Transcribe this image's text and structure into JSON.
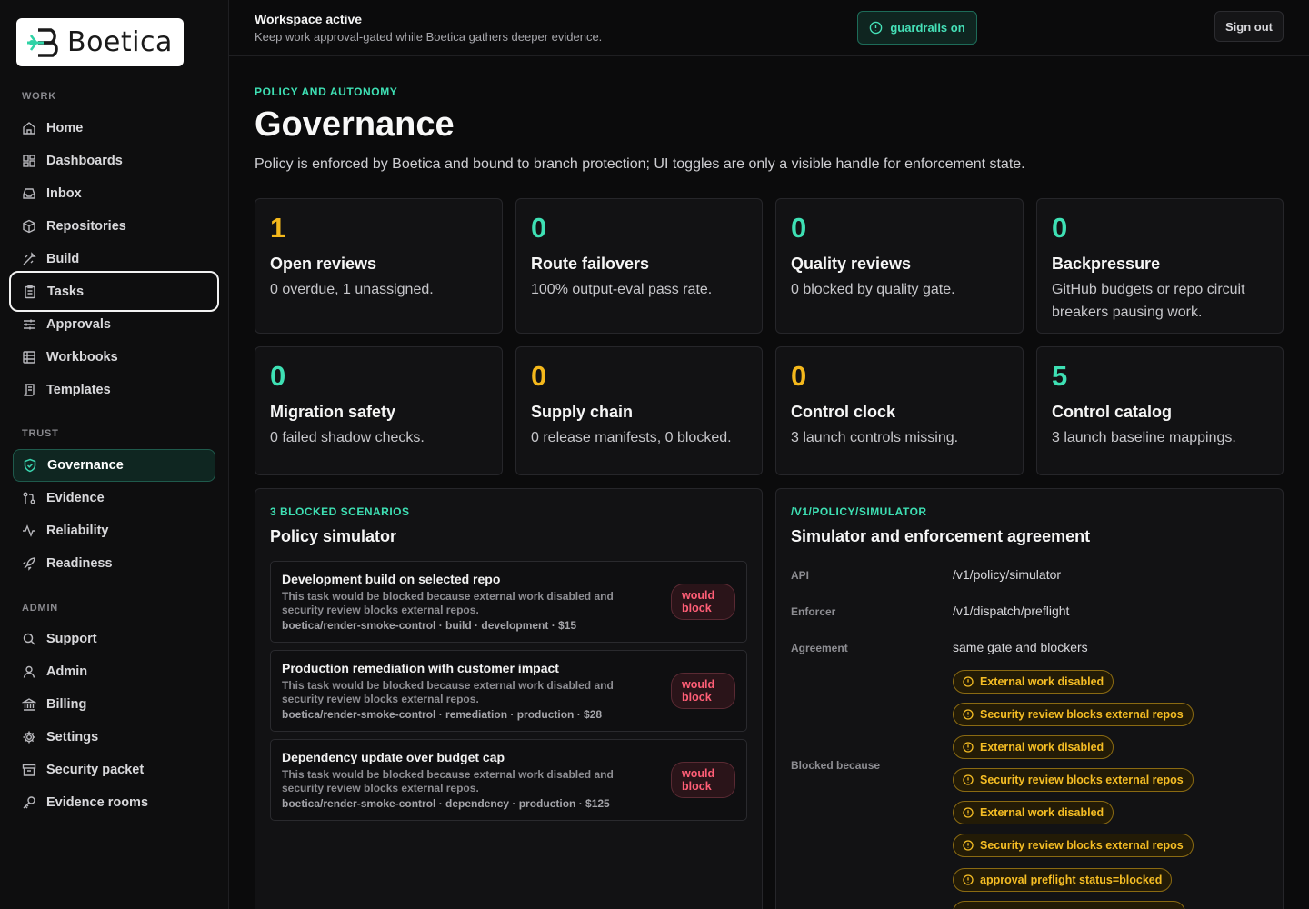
{
  "brand": {
    "name": "Boetica"
  },
  "sidebar": {
    "sections": [
      {
        "label": "WORK"
      },
      {
        "label": "TRUST"
      },
      {
        "label": "ADMIN"
      }
    ],
    "items": [
      {
        "label": "Home",
        "icon": "home-icon"
      },
      {
        "label": "Dashboards",
        "icon": "dashboard-icon"
      },
      {
        "label": "Inbox",
        "icon": "inbox-icon"
      },
      {
        "label": "Repositories",
        "icon": "package-icon"
      },
      {
        "label": "Build",
        "icon": "build-icon"
      },
      {
        "label": "Tasks",
        "icon": "clipboard-icon"
      },
      {
        "label": "Approvals",
        "icon": "sliders-icon"
      },
      {
        "label": "Workbooks",
        "icon": "table-icon"
      },
      {
        "label": "Templates",
        "icon": "scroll-icon"
      },
      {
        "label": "Governance",
        "icon": "shield-check-icon"
      },
      {
        "label": "Evidence",
        "icon": "git-compare-icon"
      },
      {
        "label": "Reliability",
        "icon": "activity-icon"
      },
      {
        "label": "Readiness",
        "icon": "rocket-icon"
      },
      {
        "label": "Support",
        "icon": "search-icon"
      },
      {
        "label": "Admin",
        "icon": "user-icon"
      },
      {
        "label": "Billing",
        "icon": "bank-icon"
      },
      {
        "label": "Settings",
        "icon": "gear-icon"
      },
      {
        "label": "Security packet",
        "icon": "archive-icon"
      },
      {
        "label": "Evidence rooms",
        "icon": "key-icon"
      }
    ]
  },
  "topbar": {
    "title": "Workspace active",
    "subtitle": "Keep work approval-gated while Boetica gathers deeper evidence.",
    "guard_label": "guardrails on",
    "signout_label": "Sign out"
  },
  "page": {
    "eyebrow": "POLICY AND AUTONOMY",
    "title": "Governance",
    "description": "Policy is enforced by Boetica and bound to branch protection; UI toggles are only a visible handle for enforcement state."
  },
  "cards": [
    {
      "value": "1",
      "title": "Open reviews",
      "desc": "0 overdue, 1 unassigned.",
      "color": "#f4b81c"
    },
    {
      "value": "0",
      "title": "Route failovers",
      "desc": "100% output-eval pass rate.",
      "color": "#3ee0b4"
    },
    {
      "value": "0",
      "title": "Quality reviews",
      "desc": "0 blocked by quality gate.",
      "color": "#3ee0b4"
    },
    {
      "value": "0",
      "title": "Backpressure",
      "desc": "GitHub budgets or repo circuit breakers pausing work.",
      "color": "#3ee0b4"
    },
    {
      "value": "0",
      "title": "Migration safety",
      "desc": "0 failed shadow checks.",
      "color": "#3ee0b4"
    },
    {
      "value": "0",
      "title": "Supply chain",
      "desc": "0 release manifests, 0 blocked.",
      "color": "#f4b81c"
    },
    {
      "value": "0",
      "title": "Control clock",
      "desc": "3 launch controls missing.",
      "color": "#f4b81c"
    },
    {
      "value": "5",
      "title": "Control catalog",
      "desc": "3 launch baseline mappings.",
      "color": "#3ee0b4"
    }
  ],
  "simulator": {
    "eyebrow": "3 BLOCKED SCENARIOS",
    "title": "Policy simulator",
    "scenarios": [
      {
        "title": "Development build on selected repo",
        "desc": "This task would be blocked because external work disabled and security review blocks external repos.",
        "meta": "boetica/render-smoke-control · build · development · $15",
        "badge": "would block"
      },
      {
        "title": "Production remediation with customer impact",
        "desc": "This task would be blocked because external work disabled and security review blocks external repos.",
        "meta": "boetica/render-smoke-control · remediation · production · $28",
        "badge": "would block"
      },
      {
        "title": "Dependency update over budget cap",
        "desc": "This task would be blocked because external work disabled and security review blocks external repos.",
        "meta": "boetica/render-smoke-control · dependency · production · $125",
        "badge": "would block"
      }
    ]
  },
  "agreement": {
    "eyebrow": "/V1/POLICY/SIMULATOR",
    "title": "Simulator and enforcement agreement",
    "rows": [
      {
        "key": "API",
        "value": "/v1/policy/simulator"
      },
      {
        "key": "Enforcer",
        "value": "/v1/dispatch/preflight"
      },
      {
        "key": "Agreement",
        "value": "same gate and blockers"
      }
    ],
    "blocked_label": "Blocked because",
    "reasons": [
      "External work disabled",
      "Security review blocks external repos",
      "External work disabled",
      "Security review blocks external repos",
      "External work disabled",
      "Security review blocks external repos",
      "approval preflight status=blocked"
    ]
  }
}
